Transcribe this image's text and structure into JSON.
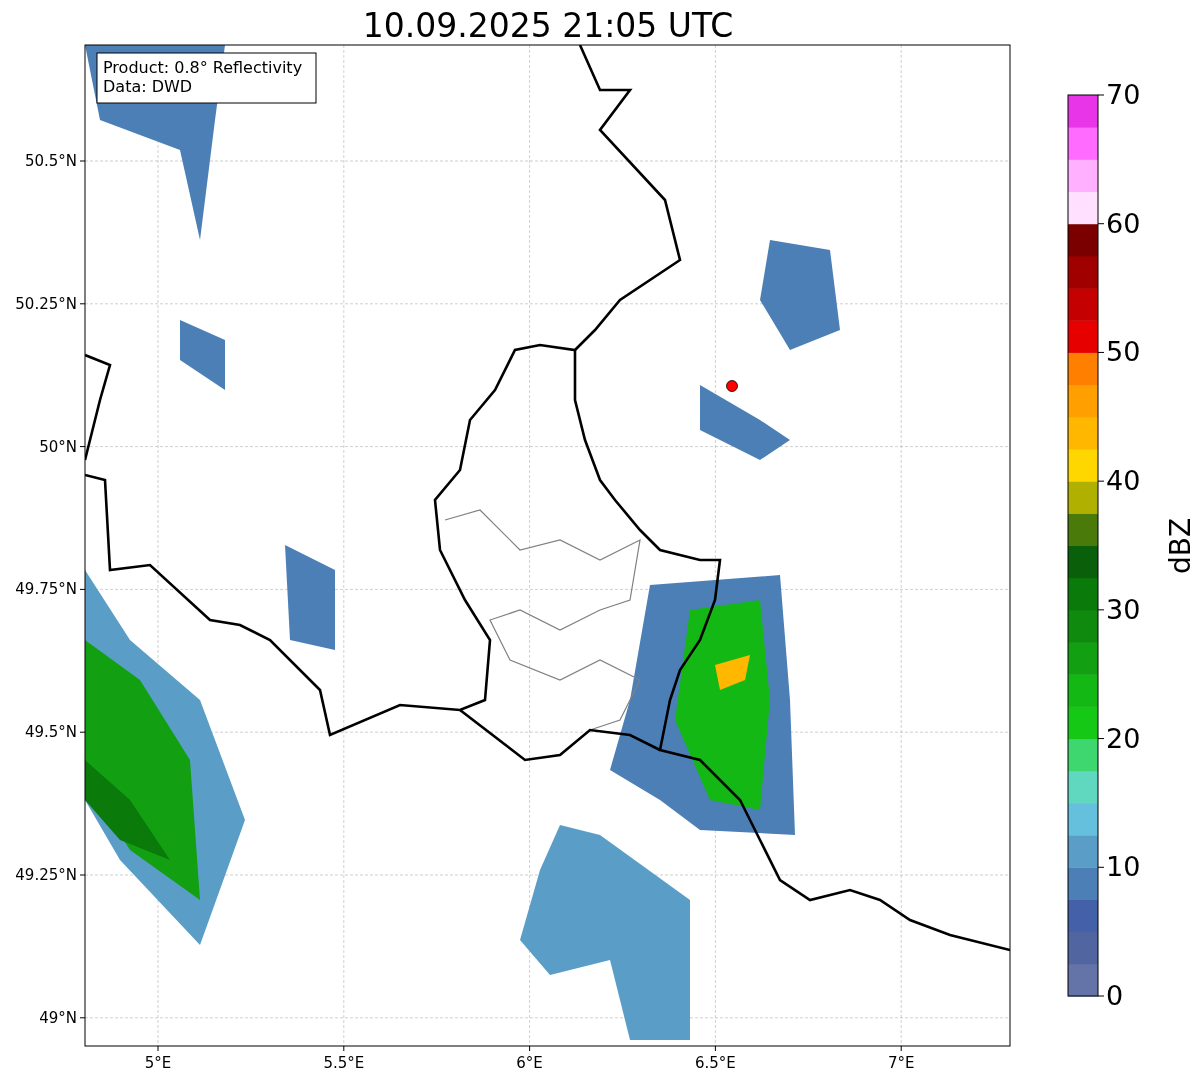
{
  "title": "10.09.2025 21:05 UTC",
  "annotation": [
    "Product: 0.8° Reflectivity",
    "Data: DWD"
  ],
  "y_ticks": [
    "50.5°N",
    "50.25°N",
    "50°N",
    "49.75°N",
    "49.5°N",
    "49.25°N",
    "49°N"
  ],
  "x_ticks": [
    "5°E",
    "5.5°E",
    "6°E",
    "6.5°E",
    "7°E"
  ],
  "colorbar": {
    "label": "dBZ",
    "ticks": [
      "70",
      "60",
      "50",
      "40",
      "30",
      "20",
      "10",
      "0"
    ],
    "bins": [
      {
        "color": "#6474a8"
      },
      {
        "color": "#5166a0"
      },
      {
        "color": "#4460a8"
      },
      {
        "color": "#4c7fb6"
      },
      {
        "color": "#5a9ec8"
      },
      {
        "color": "#64c0dc"
      },
      {
        "color": "#60d8c0"
      },
      {
        "color": "#3ed66e"
      },
      {
        "color": "#16c816"
      },
      {
        "color": "#14b814"
      },
      {
        "color": "#12a012"
      },
      {
        "color": "#0f8a0f"
      },
      {
        "color": "#0a7a0a"
      },
      {
        "color": "#0a5f0a"
      },
      {
        "color": "#4a7a0a"
      },
      {
        "color": "#b0b000"
      },
      {
        "color": "#ffd700"
      },
      {
        "color": "#ffb700"
      },
      {
        "color": "#ff9f00"
      },
      {
        "color": "#ff7f00"
      },
      {
        "color": "#e60000"
      },
      {
        "color": "#c40000"
      },
      {
        "color": "#a00000"
      },
      {
        "color": "#7a0000"
      },
      {
        "color": "#ffe0ff"
      },
      {
        "color": "#ffb0ff"
      },
      {
        "color": "#ff6bff"
      },
      {
        "color": "#e835e8"
      }
    ]
  }
}
